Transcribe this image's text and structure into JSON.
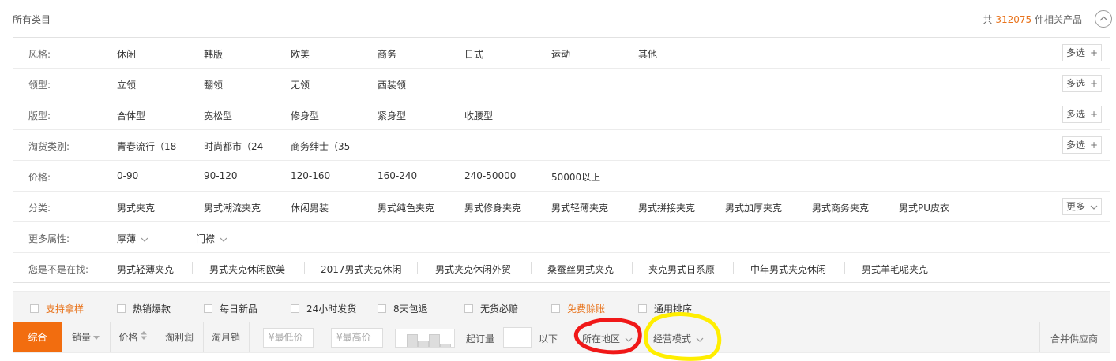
{
  "header": {
    "title": "所有类目",
    "count_prefix": "共",
    "count_value": "312075",
    "count_suffix": "件相关产品"
  },
  "filters": [
    {
      "label": "风格:",
      "options": [
        "休闲",
        "韩版",
        "欧美",
        "商务",
        "日式",
        "运动",
        "其他"
      ],
      "button": "多选"
    },
    {
      "label": "领型:",
      "options": [
        "立领",
        "翻领",
        "无领",
        "西装领"
      ],
      "button": "多选"
    },
    {
      "label": "版型:",
      "options": [
        "合体型",
        "宽松型",
        "修身型",
        "紧身型",
        "收腰型"
      ],
      "button": "多选"
    },
    {
      "label": "淘货类别:",
      "options": [
        "青春流行（18-",
        "时尚都市（24-",
        "商务绅士（35"
      ],
      "button": "多选"
    },
    {
      "label": "价格:",
      "options": [
        "0-90",
        "90-120",
        "120-160",
        "160-240",
        "240-50000",
        "50000以上"
      ]
    },
    {
      "label": "分类:",
      "options": [
        "男式夹克",
        "男式潮流夹克",
        "休闲男装",
        "男式纯色夹克",
        "男式修身夹克",
        "男式轻薄夹克",
        "男式拼接夹克",
        "男式加厚夹克",
        "男式商务夹克",
        "男式PU皮衣"
      ],
      "button": "更多"
    },
    {
      "label": "更多属性:",
      "options": [
        "厚薄",
        "门襟"
      ]
    },
    {
      "label": "您是不是在找:",
      "options": [
        "男式轻薄夹克",
        "男式夹克休闲欧美",
        "2017男式夹克休闲",
        "男式夹克休闲外贸",
        "桑蚕丝男式夹克",
        "夹克男式日系原",
        "中年男式夹克休闲",
        "男式羊毛呢夹克"
      ]
    }
  ],
  "checkboxes": [
    "支持拿样",
    "热销爆款",
    "每日新品",
    "24小时发货",
    "8天包退",
    "无货必赔",
    "免费赊账",
    "通用排序"
  ],
  "sort_bar": {
    "items": [
      "综合",
      "销量",
      "价格",
      "淘利润",
      "淘月销"
    ],
    "price_min_placeholder": "¥最低价",
    "price_max_placeholder": "¥最高价",
    "dash": "–",
    "moq_label": "起订量",
    "moq_suffix": "以下",
    "region": "所在地区",
    "mode": "经营模式",
    "merge": "合并供应商"
  },
  "colors": {
    "accent": "#f26d0f",
    "highlight": "#e8731c",
    "annot_red": "#f01818",
    "annot_yellow": "#ffee00"
  }
}
